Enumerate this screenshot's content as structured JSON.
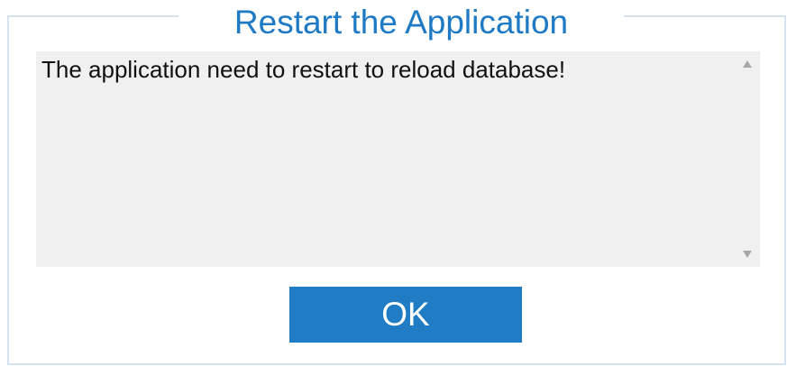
{
  "dialog": {
    "title": "Restart the Application",
    "message": "The application need to restart to reload database!",
    "ok_label": "OK"
  },
  "colors": {
    "accent": "#1f7cc5",
    "title_text": "#1e7ac4",
    "message_background": "#f0f0f0",
    "frame": "#d6e1ee"
  },
  "icons": {
    "scroll_up": "scroll-up-arrow-icon",
    "scroll_down": "scroll-down-arrow-icon"
  }
}
